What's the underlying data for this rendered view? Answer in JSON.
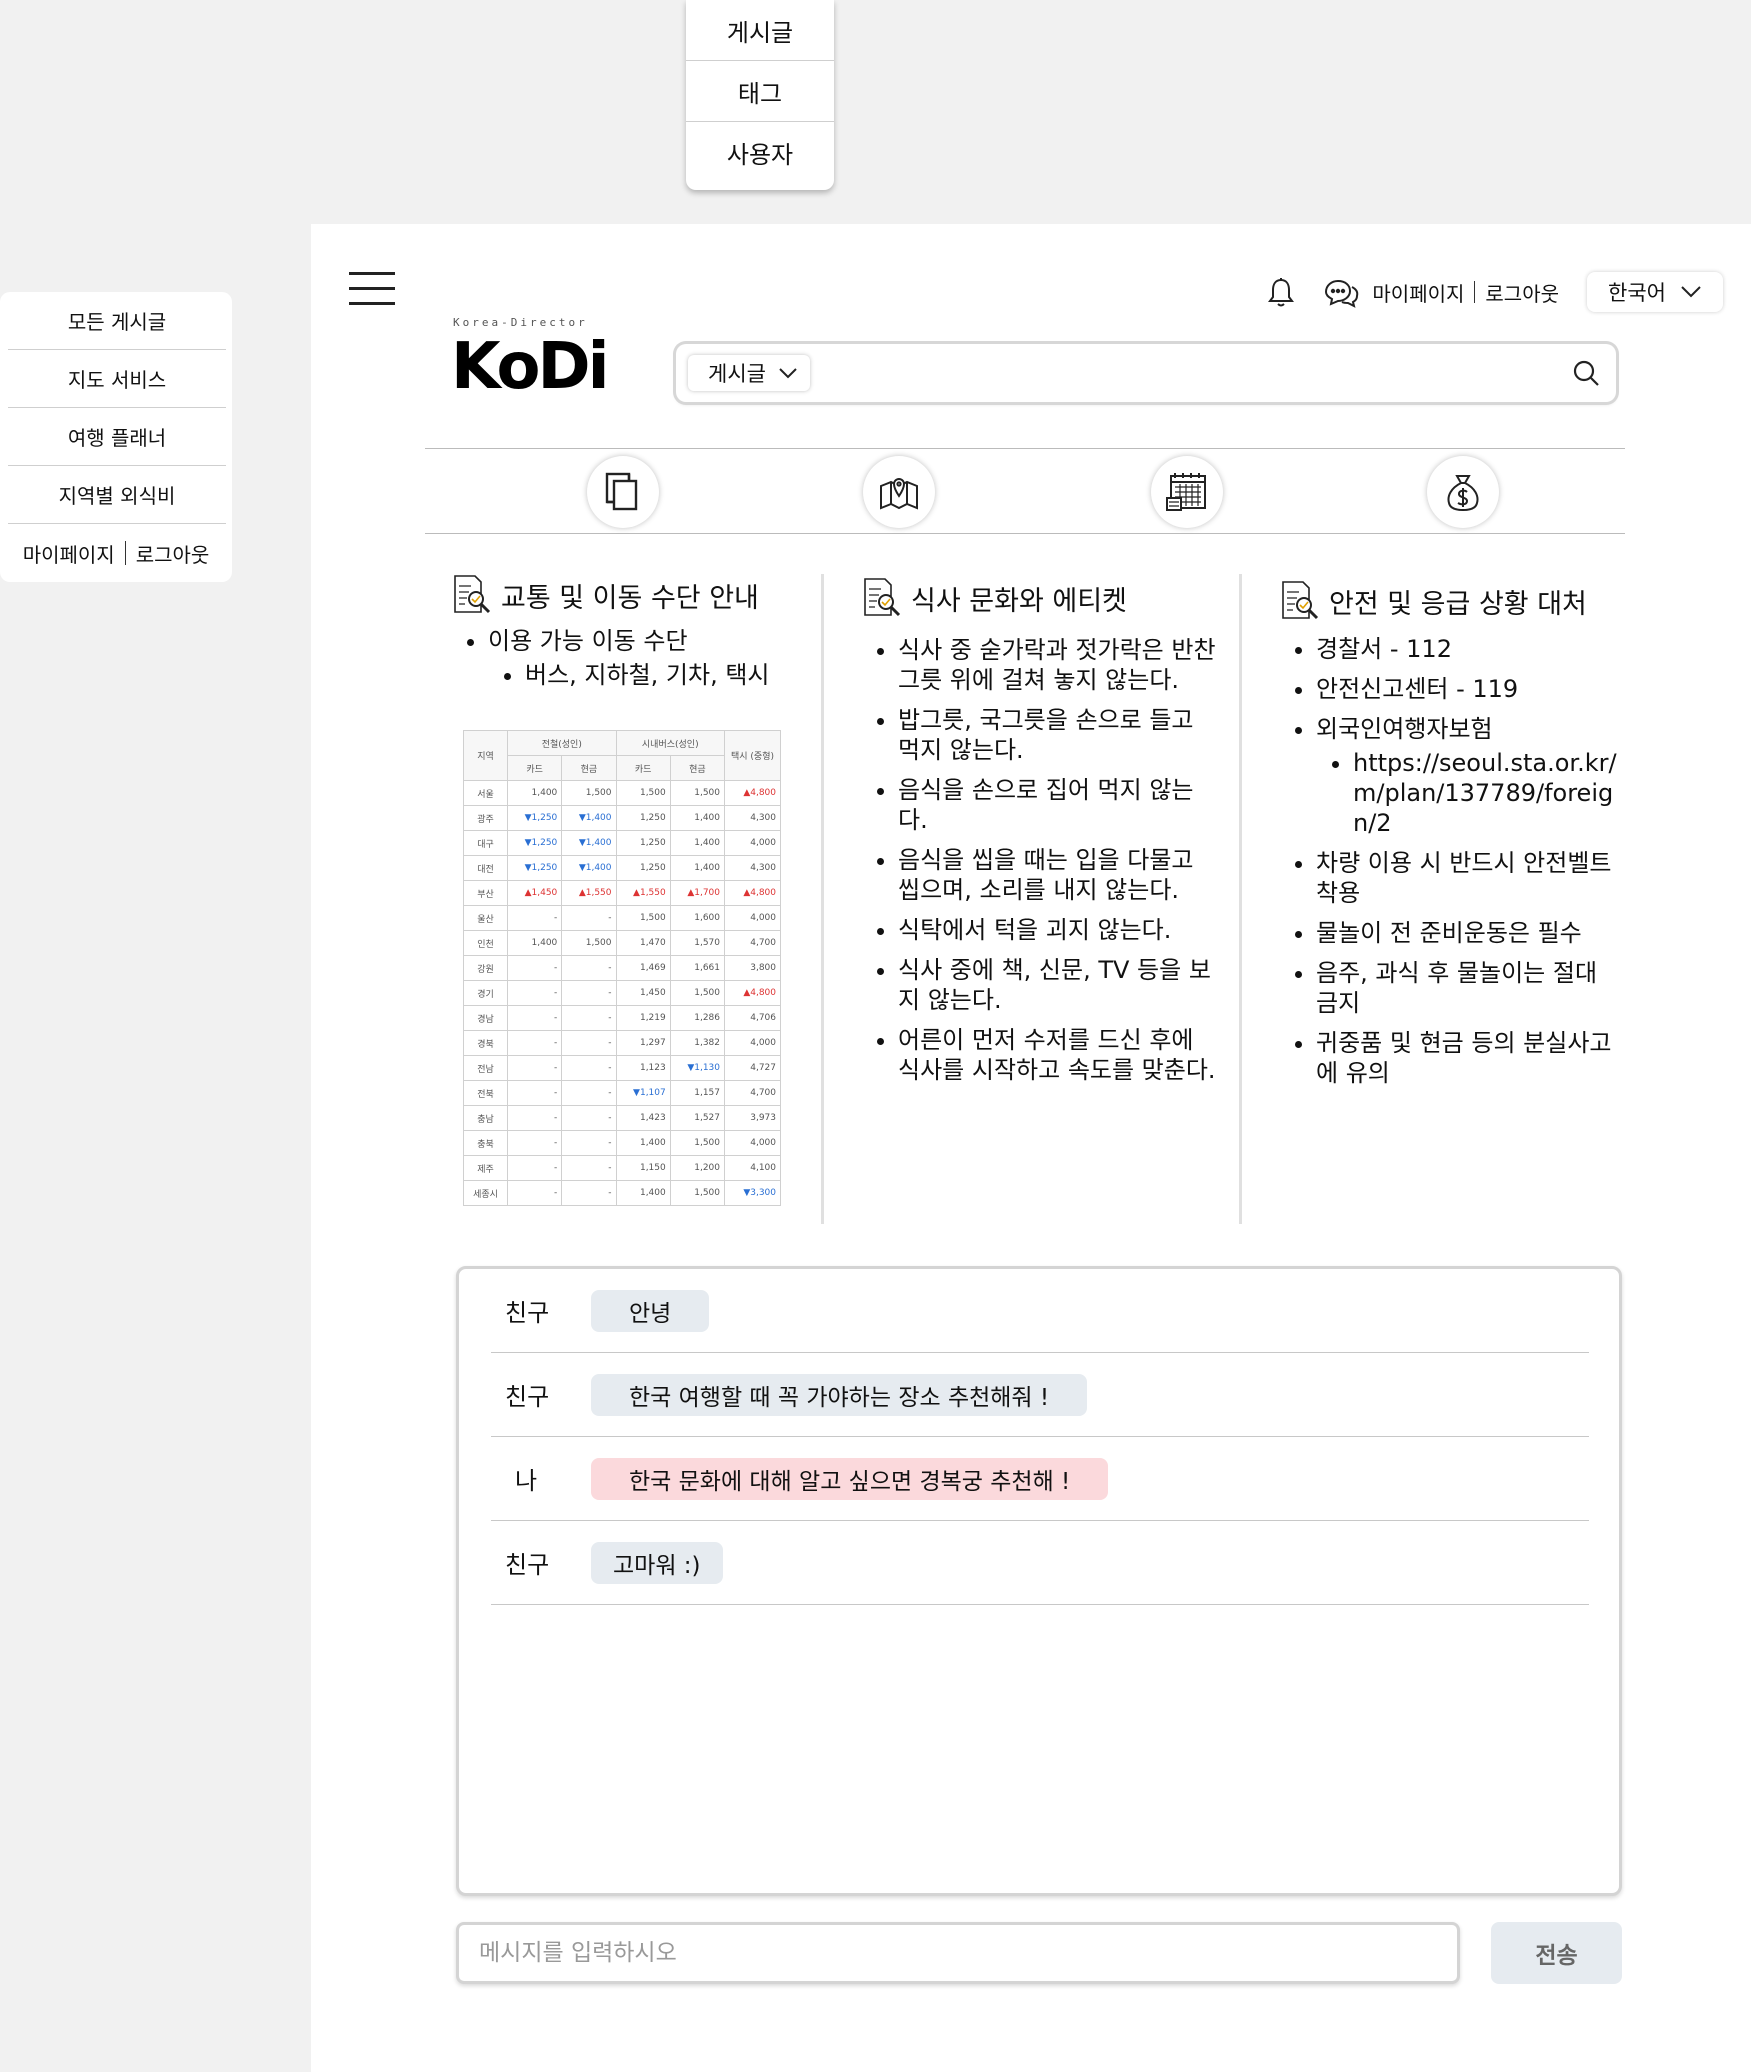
{
  "search_scope_menu": {
    "items": [
      "게시글",
      "태그",
      "사용자"
    ]
  },
  "side_menu": {
    "items": [
      "모든 게시글",
      "지도 서비스",
      "여행 플래너",
      "지역별 외식비"
    ],
    "mypage": "마이페이지",
    "logout": "로그아웃"
  },
  "header": {
    "mypage": "마이페이지",
    "logout": "로그아웃",
    "language": "한국어",
    "logo_tagline": "Korea-Director",
    "logo_text": "KoDi"
  },
  "search": {
    "scope": "게시글",
    "value": "",
    "placeholder": ""
  },
  "nav_icons": [
    "documents-icon",
    "map-icon",
    "planner-icon",
    "money-bag-icon"
  ],
  "info": {
    "transport": {
      "title": "교통 및 이동 수단 안내",
      "item": "이용 가능 이동 수단",
      "sub_item": "버스, 지하철, 기차, 택시"
    },
    "dining": {
      "title": "식사 문화와 에티켓",
      "items": [
        "식사 중 숟가락과 젓가락은 반찬 그릇 위에 걸쳐 놓지 않는다.",
        "밥그릇, 국그릇을 손으로 들고 먹지 않는다.",
        "음식을 손으로 집어 먹지 않는다.",
        "음식을 씹을 때는 입을 다물고 씹으며, 소리를 내지 않는다.",
        "식탁에서 턱을 괴지 않는다.",
        "식사 중에 책, 신문, TV 등을 보지 않는다.",
        "어른이 먼저 수저를 드신 후에 식사를 시작하고 속도를 맞춘다."
      ]
    },
    "safety": {
      "title": "안전 및 응급 상황 대처",
      "items": [
        "경찰서 - 112",
        "안전신고센터 - 119",
        "외국인여행자보험"
      ],
      "insurance_url": "https://seoul.sta.or.kr/m/plan/137789/foreign/2",
      "items_after": [
        "차량 이용 시 반드시 안전벨트 착용",
        "물놀이 전 준비운동은 필수",
        "음주, 과식 후 물놀이는 절대 금지",
        "귀중품 및 현금 등의 분실사고에 유의"
      ]
    }
  },
  "fare_table": {
    "region_header": "지역",
    "subway_header": "전철(성인)",
    "bus_header": "시내버스(성인)",
    "taxi_header": "택시 (중형)",
    "card": "카드",
    "cash": "현금",
    "rows": [
      {
        "region": "서울",
        "subway_card": "1,400",
        "subway_cash": "1,500",
        "bus_card": "1,500",
        "bus_cash": "1,500",
        "taxi": "4,800",
        "trend": {
          "taxi": "up"
        }
      },
      {
        "region": "광주",
        "subway_card": "1,250",
        "subway_cash": "1,400",
        "bus_card": "1,250",
        "bus_cash": "1,400",
        "taxi": "4,300",
        "trend": {
          "subway_card": "down",
          "subway_cash": "down"
        }
      },
      {
        "region": "대구",
        "subway_card": "1,250",
        "subway_cash": "1,400",
        "bus_card": "1,250",
        "bus_cash": "1,400",
        "taxi": "4,000",
        "trend": {
          "subway_card": "down",
          "subway_cash": "down"
        }
      },
      {
        "region": "대전",
        "subway_card": "1,250",
        "subway_cash": "1,400",
        "bus_card": "1,250",
        "bus_cash": "1,400",
        "taxi": "4,300",
        "trend": {
          "subway_card": "down",
          "subway_cash": "down"
        }
      },
      {
        "region": "부산",
        "subway_card": "1,450",
        "subway_cash": "1,550",
        "bus_card": "1,550",
        "bus_cash": "1,700",
        "taxi": "4,800",
        "trend": {
          "subway_card": "up",
          "subway_cash": "up",
          "bus_card": "up",
          "bus_cash": "up",
          "taxi": "up"
        }
      },
      {
        "region": "울산",
        "subway_card": "-",
        "subway_cash": "-",
        "bus_card": "1,500",
        "bus_cash": "1,600",
        "taxi": "4,000",
        "trend": {}
      },
      {
        "region": "인천",
        "subway_card": "1,400",
        "subway_cash": "1,500",
        "bus_card": "1,470",
        "bus_cash": "1,570",
        "taxi": "4,700",
        "trend": {}
      },
      {
        "region": "강원",
        "subway_card": "-",
        "subway_cash": "-",
        "bus_card": "1,469",
        "bus_cash": "1,661",
        "taxi": "3,800",
        "trend": {}
      },
      {
        "region": "경기",
        "subway_card": "-",
        "subway_cash": "-",
        "bus_card": "1,450",
        "bus_cash": "1,500",
        "taxi": "4,800",
        "trend": {
          "taxi": "up"
        }
      },
      {
        "region": "경남",
        "subway_card": "-",
        "subway_cash": "-",
        "bus_card": "1,219",
        "bus_cash": "1,286",
        "taxi": "4,706",
        "trend": {}
      },
      {
        "region": "경북",
        "subway_card": "-",
        "subway_cash": "-",
        "bus_card": "1,297",
        "bus_cash": "1,382",
        "taxi": "4,000",
        "trend": {}
      },
      {
        "region": "전남",
        "subway_card": "-",
        "subway_cash": "-",
        "bus_card": "1,123",
        "bus_cash": "1,130",
        "taxi": "4,727",
        "trend": {
          "bus_cash": "down"
        }
      },
      {
        "region": "전북",
        "subway_card": "-",
        "subway_cash": "-",
        "bus_card": "1,107",
        "bus_cash": "1,157",
        "taxi": "4,700",
        "trend": {
          "bus_card": "down"
        }
      },
      {
        "region": "충남",
        "subway_card": "-",
        "subway_cash": "-",
        "bus_card": "1,423",
        "bus_cash": "1,527",
        "taxi": "3,973",
        "trend": {}
      },
      {
        "region": "충북",
        "subway_card": "-",
        "subway_cash": "-",
        "bus_card": "1,400",
        "bus_cash": "1,500",
        "taxi": "4,000",
        "trend": {}
      },
      {
        "region": "제주",
        "subway_card": "-",
        "subway_cash": "-",
        "bus_card": "1,150",
        "bus_cash": "1,200",
        "taxi": "4,100",
        "trend": {}
      },
      {
        "region": "세종시",
        "subway_card": "-",
        "subway_cash": "-",
        "bus_card": "1,400",
        "bus_cash": "1,500",
        "taxi": "3,300",
        "trend": {
          "taxi": "down"
        }
      }
    ]
  },
  "chat": {
    "messages": [
      {
        "sender": "친구",
        "text": "안녕",
        "mine": false
      },
      {
        "sender": "친구",
        "text": "한국 여행할 때 꼭 가야하는 장소 추천해줘 !",
        "mine": false
      },
      {
        "sender": "나",
        "text": "한국 문화에 대해 알고 싶으면 경복궁 추천해 !",
        "mine": true
      },
      {
        "sender": "친구",
        "text": "고마워 :)",
        "mine": false
      }
    ],
    "input_placeholder": "메시지를 입력하시오",
    "input_value": "",
    "send_label": "전송"
  },
  "colors": {
    "friend_bubble": "#e6ebf0",
    "my_bubble": "#fbd9dc",
    "fare_up": "#d33333",
    "fare_down": "#2a6fd3"
  }
}
